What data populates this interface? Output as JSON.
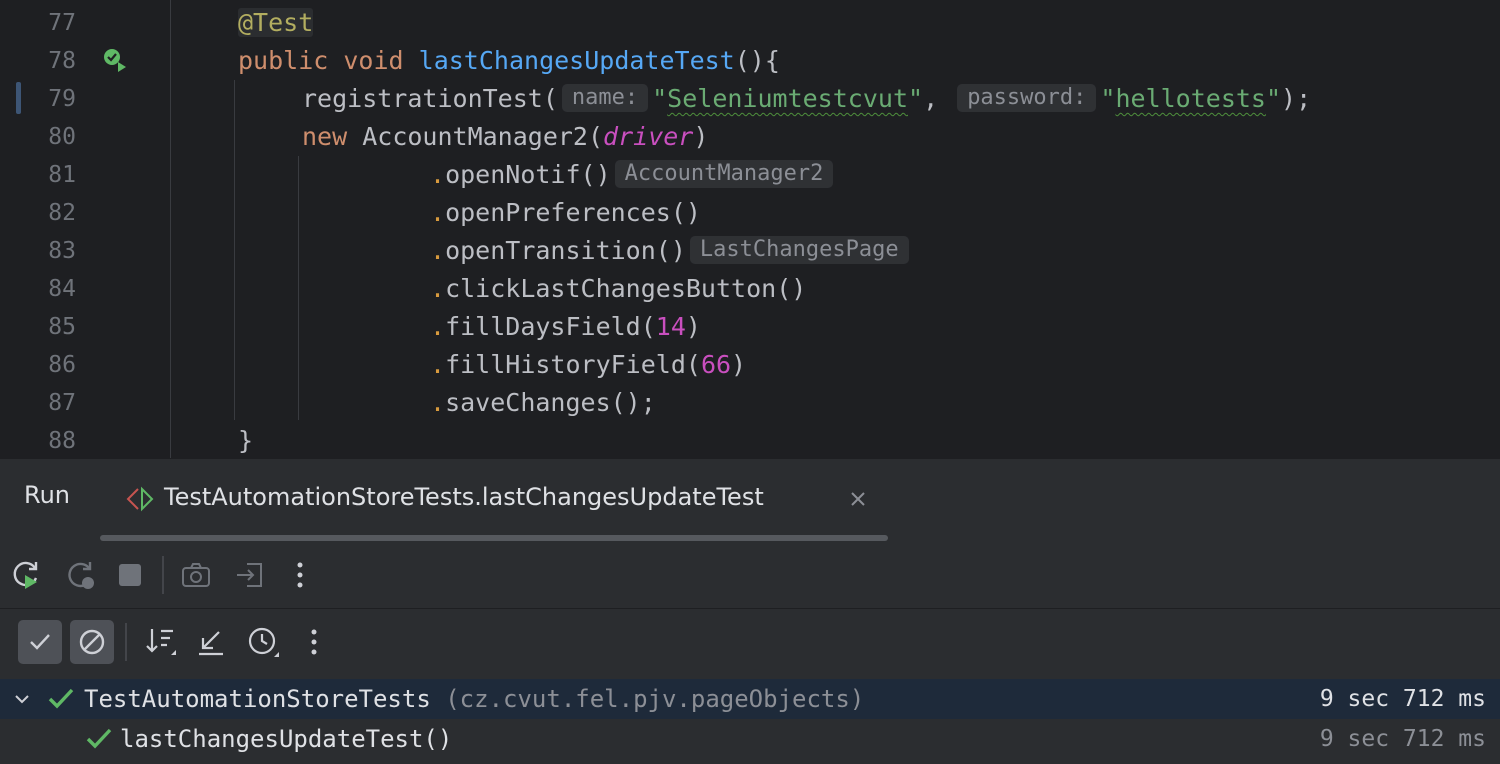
{
  "editor": {
    "lines": [
      {
        "n": "77"
      },
      {
        "n": "78"
      },
      {
        "n": "79"
      },
      {
        "n": "80"
      },
      {
        "n": "81"
      },
      {
        "n": "82"
      },
      {
        "n": "83"
      },
      {
        "n": "84"
      },
      {
        "n": "85"
      },
      {
        "n": "86"
      },
      {
        "n": "87"
      },
      {
        "n": "88"
      }
    ],
    "annotation": "@Test",
    "kw_public": "public",
    "kw_void": "void",
    "method_name": "lastChangesUpdateTest",
    "method_open": "(){",
    "call_registration": "registrationTest(",
    "hint_name": "name:",
    "arg_user": "Seleniumtestcvut",
    "comma": ",",
    "hint_password": "password:",
    "arg_password": "hellotests",
    "call_close": ");",
    "kw_new": "new",
    "class_name": "AccountManager2(",
    "param_driver": "driver",
    "paren_close": ")",
    "chain": [
      {
        "call": "openNotif()",
        "hint": "AccountManager2"
      },
      {
        "call": "openPreferences()",
        "hint": ""
      },
      {
        "call": "openTransition()",
        "hint": "LastChangesPage"
      },
      {
        "call": "clickLastChangesButton()",
        "hint": ""
      },
      {
        "call": "fillDaysField(",
        "arg": "14",
        "close": ")"
      },
      {
        "call": "fillHistoryField(",
        "arg": "66",
        "close": ")"
      },
      {
        "call": "saveChanges();",
        "hint": ""
      }
    ],
    "closing_brace": "}"
  },
  "run_panel": {
    "title": "Run",
    "tab_label": "TestAutomationStoreTests.lastChangesUpdateTest",
    "toolbar1_icons": [
      "rerun-icon",
      "rerun-failed-icon",
      "stop-icon",
      "camera-icon",
      "export-icon",
      "more-vertical-icon"
    ],
    "toolbar2_icons": [
      "show-passed-icon",
      "show-ignored-icon",
      "sort-icon",
      "collapse-icon",
      "history-icon",
      "more-vertical-icon"
    ],
    "tree": [
      {
        "label": "TestAutomationStoreTests",
        "package": "(cz.cvut.fel.pjv.pageObjects)",
        "time": "9 sec 712 ms"
      },
      {
        "label": "lastChangesUpdateTest()",
        "time": "9 sec 712 ms"
      }
    ]
  },
  "colors": {
    "background": "#1e1f22",
    "panel": "#2b2d30",
    "passed": "#5fb865",
    "keyword": "#cf8e6d",
    "string": "#6aab73",
    "number": "#c94fbf",
    "method": "#56a8f5"
  }
}
